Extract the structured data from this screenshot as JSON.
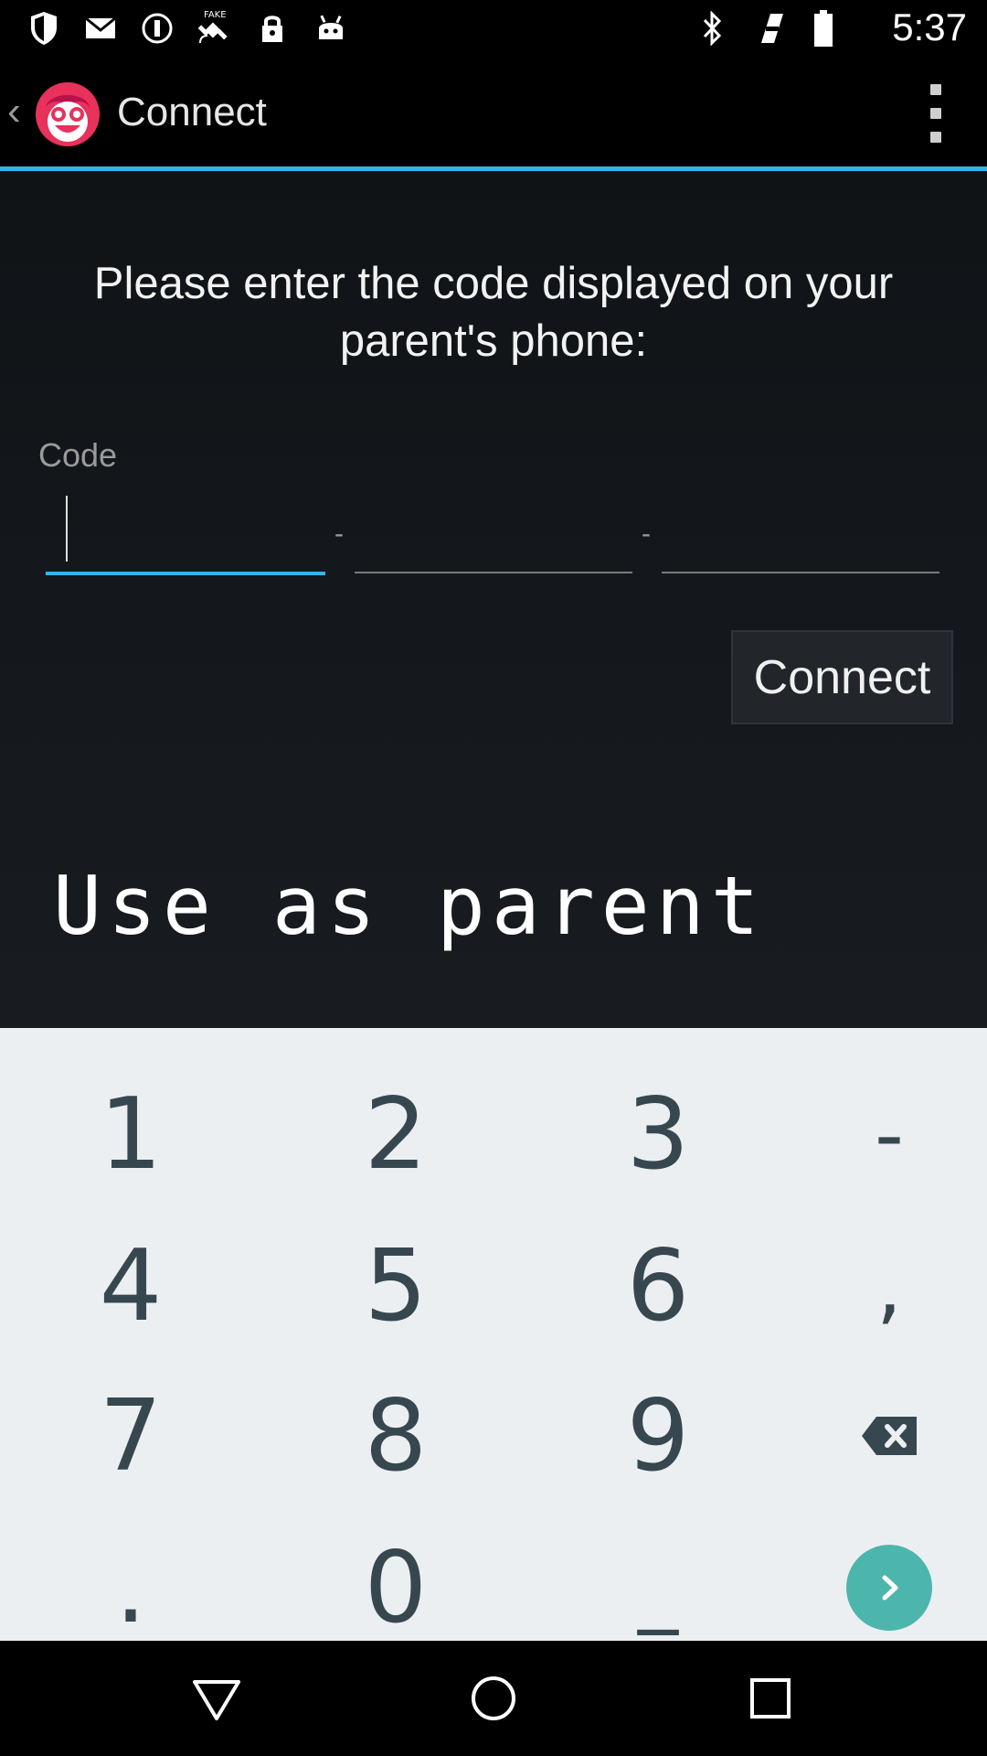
{
  "status_bar": {
    "time": "5:37",
    "icons_left": [
      "shield-icon",
      "mail-icon",
      "alert-circle-icon",
      "fake-gps-icon",
      "lock-icon",
      "android-icon"
    ],
    "icons_right": [
      "bluetooth-icon",
      "signal-off-icon",
      "battery-icon"
    ]
  },
  "action_bar": {
    "title": "Connect",
    "logo": "smiley-face-logo",
    "menu_icon": "overflow-menu-icon"
  },
  "main": {
    "prompt": "Please enter the code displayed on your parent's phone:",
    "code_label": "Code",
    "code_fields": [
      "",
      "",
      ""
    ],
    "separator": "-",
    "connect_label": "Connect",
    "use_as_parent": "Use as parent"
  },
  "keyboard": {
    "rows": [
      [
        "1",
        "2",
        "3",
        "-"
      ],
      [
        "4",
        "5",
        "6",
        ","
      ],
      [
        "7",
        "8",
        "9",
        "backspace"
      ],
      [
        ".",
        "0",
        "_",
        "go"
      ]
    ]
  },
  "colors": {
    "accent": "#33b5e5",
    "go_key": "#4db6ac",
    "keyboard_bg": "#eceff1",
    "key_text": "#37474f"
  }
}
